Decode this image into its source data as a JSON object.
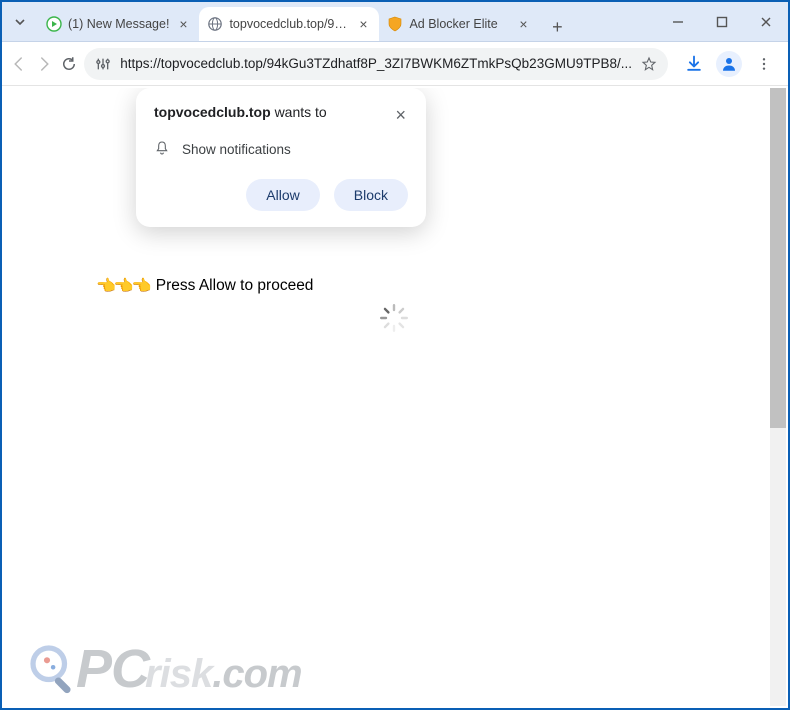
{
  "tabs": [
    {
      "title": "(1) New Message!",
      "active": false,
      "favicon": "play-green"
    },
    {
      "title": "topvocedclub.top/94kG",
      "active": true,
      "favicon": "globe"
    },
    {
      "title": "Ad Blocker Elite",
      "active": false,
      "favicon": "shield-orange"
    }
  ],
  "omnibox": {
    "url": "https://topvocedclub.top/94kGu3TZdhatf8P_3ZI7BWKM6ZTmkPsQb23GMU9TPB8/..."
  },
  "notification": {
    "domain": "topvocedclub.top",
    "wants_to": "wants to",
    "perm_label": "Show notifications",
    "allow": "Allow",
    "block": "Block"
  },
  "page": {
    "hands": "👈👈👈",
    "message": "Press Allow to proceed"
  },
  "watermark": {
    "pc": "PC",
    "r": "r",
    "isk": "isk",
    "dotcom": ".com"
  }
}
